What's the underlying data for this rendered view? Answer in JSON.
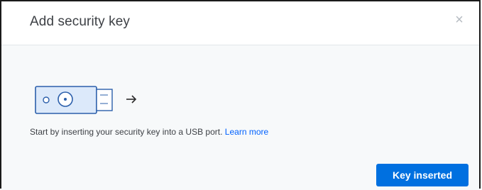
{
  "dialog": {
    "title": "Add security key",
    "close_icon": "close-icon",
    "close_glyph": "×",
    "illustration": "usb-security-key-illustration",
    "description": "Start by inserting your security key into a USB port.",
    "learn_more_label": "Learn more",
    "primary_button_label": "Key inserted"
  },
  "colors": {
    "primary": "#0070e0",
    "link": "#0061fe",
    "body_bg": "#f7f9fa",
    "key_fill": "#dce9fa",
    "key_stroke": "#2b5fab"
  }
}
